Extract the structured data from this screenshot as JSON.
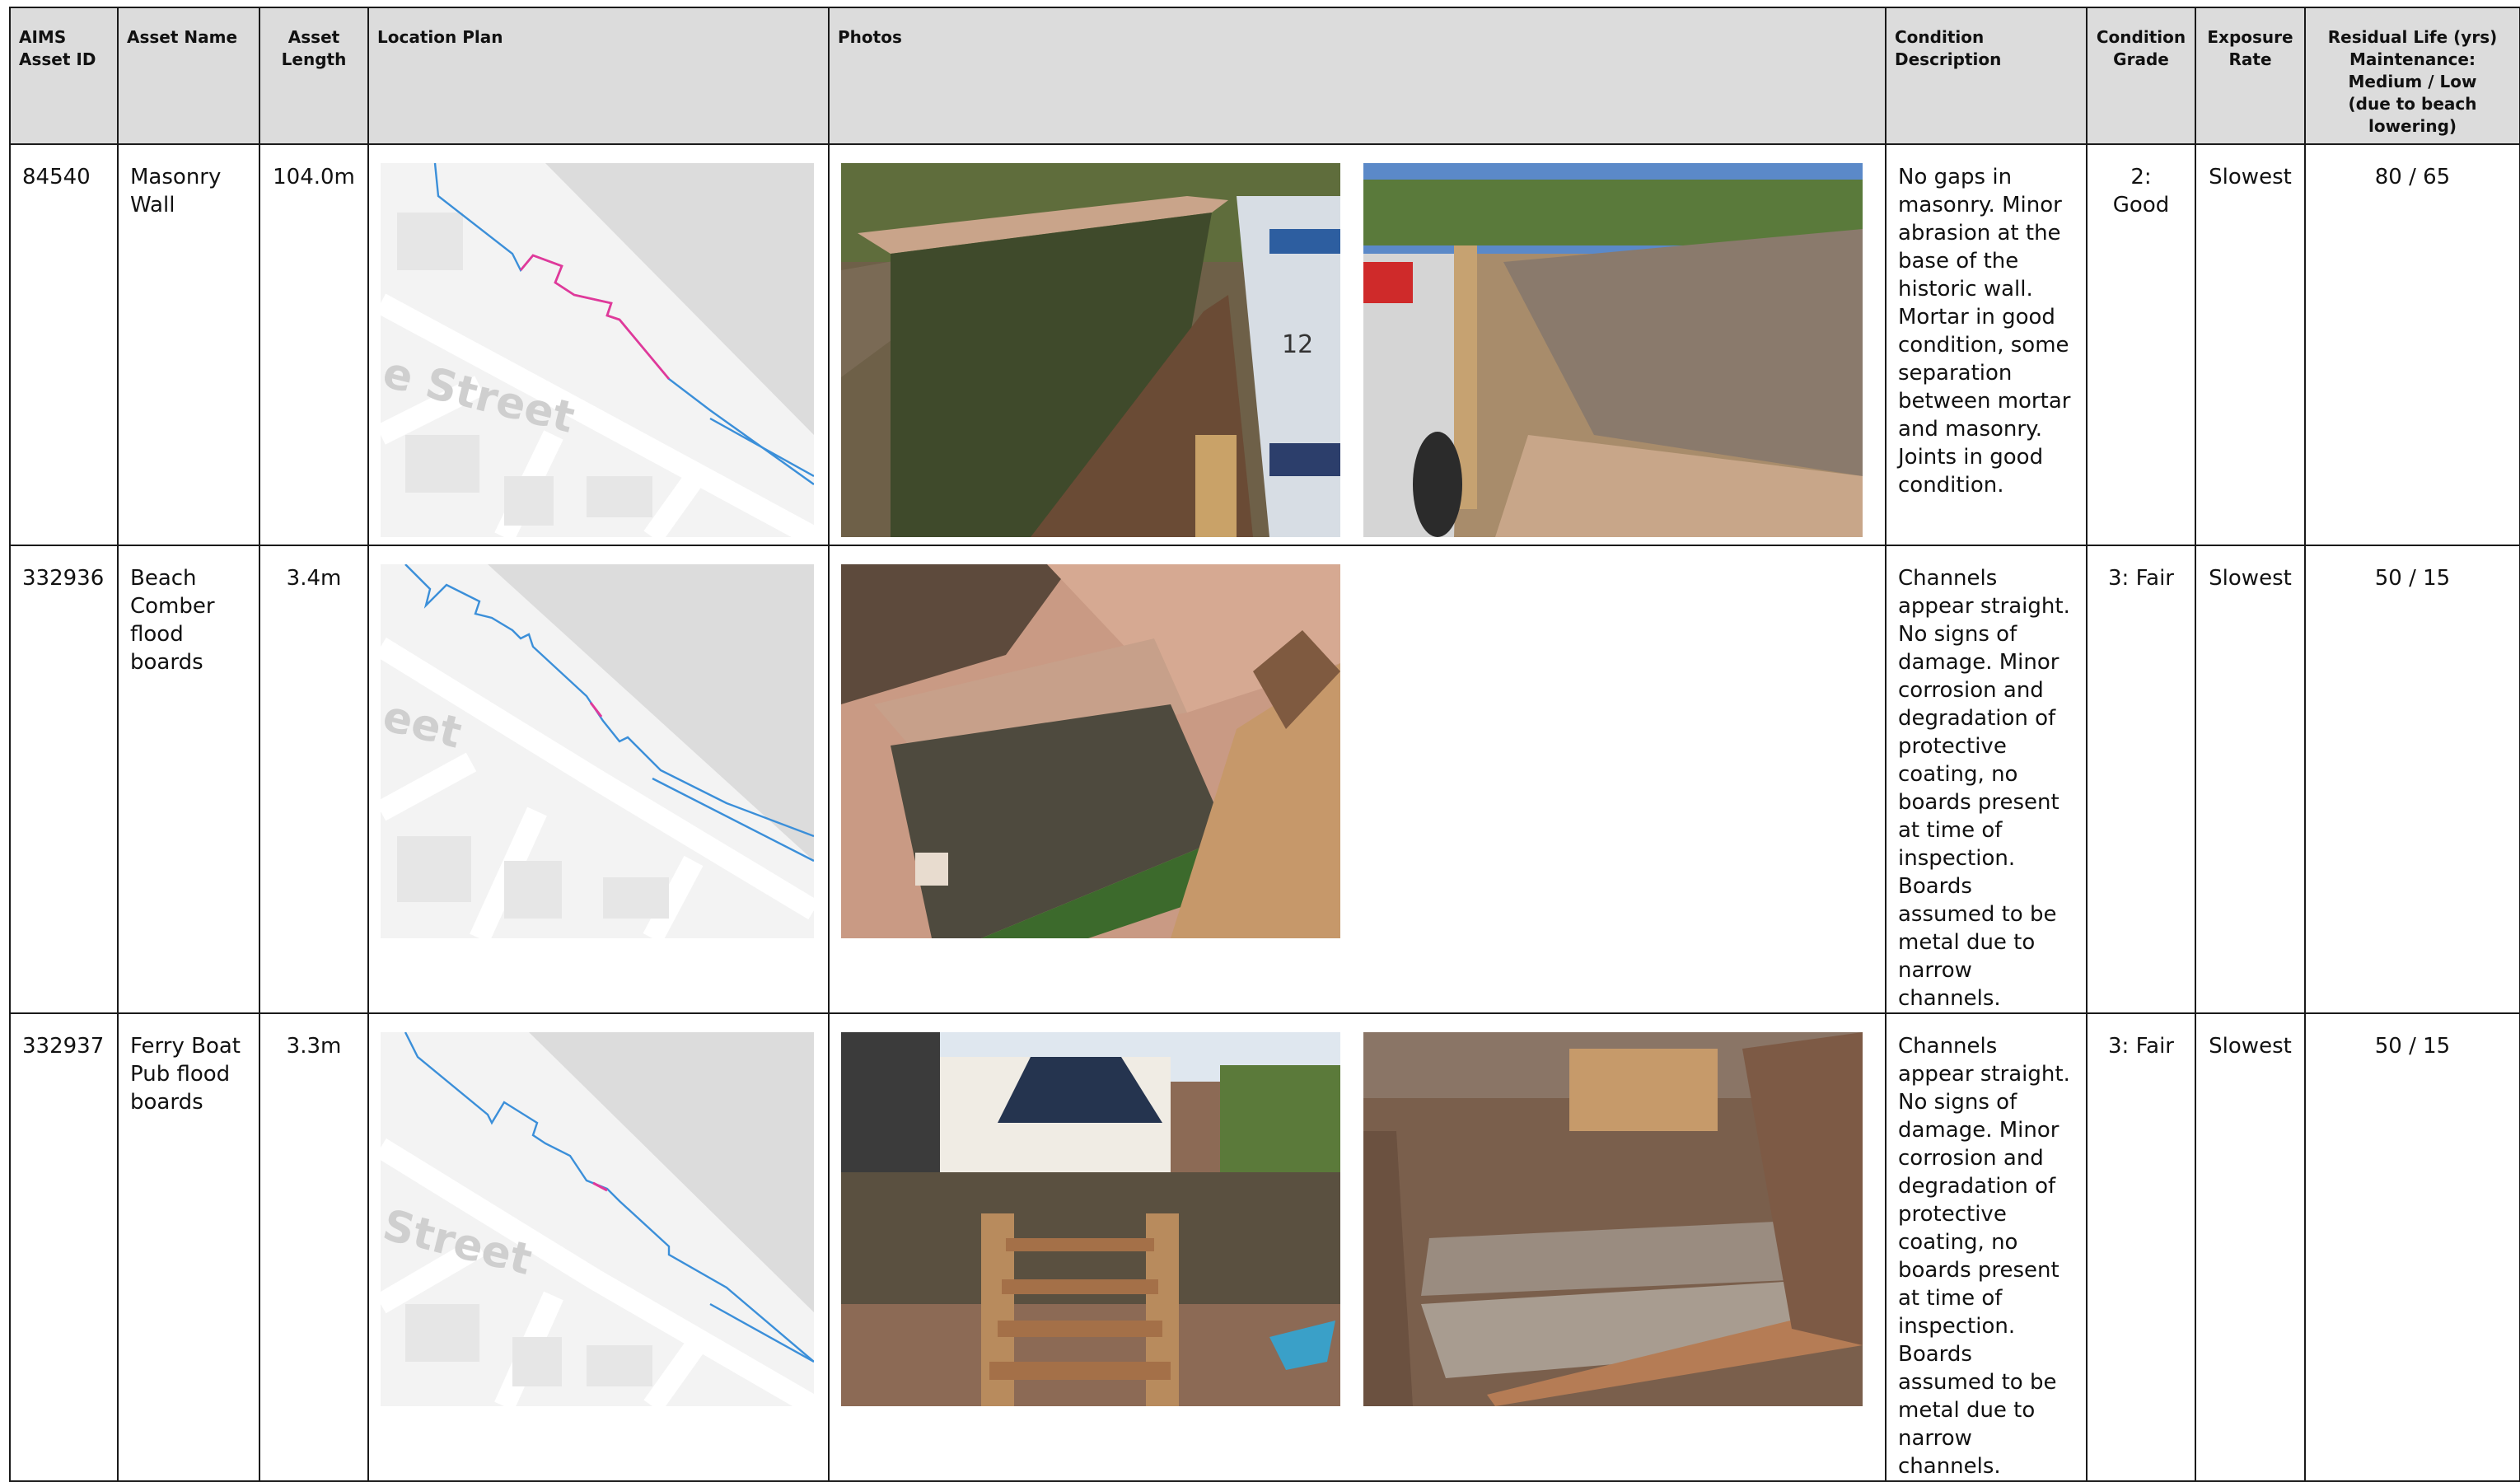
{
  "headers": {
    "asset_id": [
      "AIMS",
      "Asset ID"
    ],
    "asset_name": "Asset Name",
    "asset_length": [
      "Asset",
      "Length"
    ],
    "location_plan": "Location Plan",
    "photos": "Photos",
    "condition_description": "Condition Description",
    "condition_grade": [
      "Condition",
      "Grade"
    ],
    "exposure_rate": [
      "Exposure",
      "Rate"
    ],
    "residual_life": [
      "Residual Life (yrs)",
      "Maintenance:",
      "Medium / Low",
      "(due to beach lowering)"
    ]
  },
  "rows": [
    {
      "id": "84540",
      "name": "Masonry Wall",
      "length": "104.0m",
      "map_label": "e Street",
      "photo_label": "12",
      "description": "No gaps in masonry. Minor abrasion at the base of the historic wall. Mortar in good condition, some separation between mortar and masonry. Joints in good condition.",
      "grade": "2: Good",
      "exposure": "Slowest",
      "residual_life": "80 / 65"
    },
    {
      "id": "332936",
      "name": "Beach Comber flood boards",
      "length": "3.4m",
      "map_label": "eet",
      "description": "Channels appear straight. No signs of damage. Minor corrosion and degradation of protective coating, no boards present at time of inspection. Boards assumed to be metal due to narrow channels.",
      "grade": "3: Fair",
      "exposure": "Slowest",
      "residual_life": "50 / 15"
    },
    {
      "id": "332937",
      "name": "Ferry Boat Pub flood boards",
      "length": "3.3m",
      "map_label": "Street",
      "description": "Channels appear straight. No signs of damage. Minor corrosion and degradation of protective coating, no boards present at time of inspection. Boards assumed to be metal due to narrow channels.",
      "grade": "3: Fair",
      "exposure": "Slowest",
      "residual_life": "50 / 15"
    }
  ],
  "colors": {
    "header_bg": "#dcdcdc",
    "grid_border": "#1a1a1a",
    "map_line": "#3b8fd9",
    "map_highlight": "#e0399a",
    "map_land": "#f3f3f3",
    "map_sea": "#dcdcdc"
  },
  "icons": [
    "location-map",
    "asset-photo"
  ]
}
